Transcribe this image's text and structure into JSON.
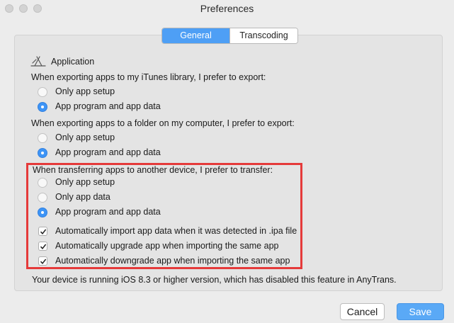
{
  "window": {
    "title": "Preferences"
  },
  "tabs": [
    {
      "label": "General",
      "active": true
    },
    {
      "label": "Transcoding",
      "active": false
    }
  ],
  "section": {
    "title": "Application",
    "icon": "app-store-icon"
  },
  "itunes_group": {
    "prompt": "When exporting apps to my iTunes library, I prefer to export:",
    "options": [
      {
        "label": "Only app setup",
        "selected": false
      },
      {
        "label": "App program and app data",
        "selected": true
      }
    ]
  },
  "folder_group": {
    "prompt": "When exporting apps to a folder on my computer, I prefer to export:",
    "options": [
      {
        "label": "Only app setup",
        "selected": false
      },
      {
        "label": "App program and app data",
        "selected": true
      }
    ]
  },
  "transfer_group": {
    "prompt": "When transferring apps to another device, I prefer to transfer:",
    "options": [
      {
        "label": "Only app setup",
        "selected": false
      },
      {
        "label": "Only app data",
        "selected": false
      },
      {
        "label": "App program and app data",
        "selected": true
      }
    ],
    "checkboxes": [
      {
        "label": "Automatically import app data when it was detected in .ipa file",
        "checked": true
      },
      {
        "label": "Automatically upgrade app when importing the same app",
        "checked": true
      },
      {
        "label": "Automatically downgrade app when importing the same app",
        "checked": true
      }
    ]
  },
  "notice": "Your device is running iOS 8.3 or higher version, which has disabled this feature in AnyTrans.",
  "buttons": {
    "cancel": "Cancel",
    "save": "Save"
  },
  "colors": {
    "accent": "#4e9ff5",
    "highlight_box": "#e53a3a"
  }
}
